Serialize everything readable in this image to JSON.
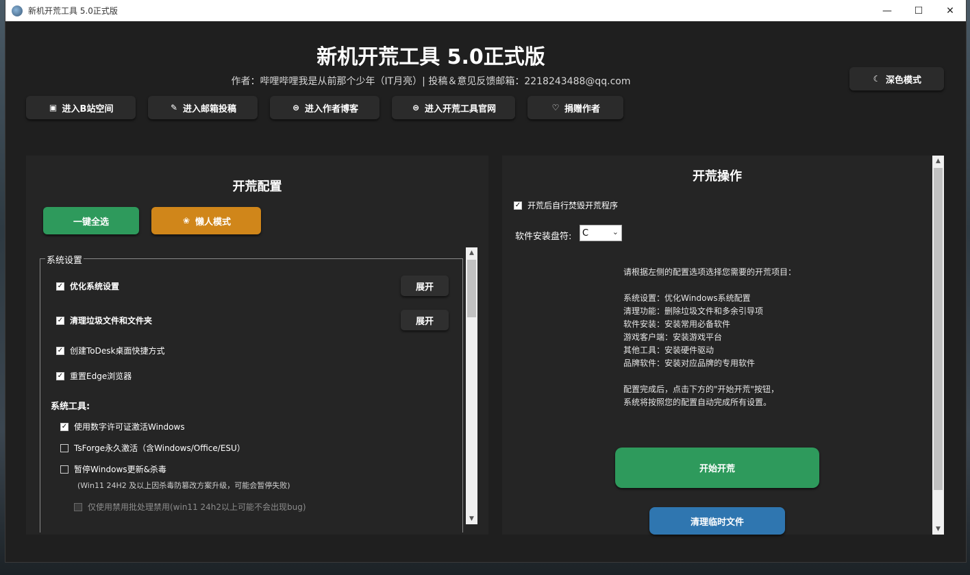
{
  "window": {
    "title": "新机开荒工具 5.0正式版",
    "minimize": "—",
    "maximize": "☐",
    "close": "✕"
  },
  "header": {
    "title": "新机开荒工具 5.0正式版",
    "subtitle": "作者：哔哩哔哩我是从前那个少年（IT月亮）| 投稿＆意见反馈邮箱：2218243488@qq.com",
    "dark_mode_label": "深色模式"
  },
  "nav": [
    {
      "label": "进入B站空间",
      "icon": "tv-icon"
    },
    {
      "label": "进入邮箱投稿",
      "icon": "edit-icon"
    },
    {
      "label": "进入作者博客",
      "icon": "globe-icon"
    },
    {
      "label": "进入开荒工具官网",
      "icon": "globe-icon"
    },
    {
      "label": "捐赠作者",
      "icon": "heart-icon"
    }
  ],
  "left": {
    "title": "开荒配置",
    "select_all": "一键全选",
    "lazy_mode": "懒人模式",
    "group_label": "系统设置",
    "items": [
      {
        "label": "优化系统设置",
        "checked": true,
        "expand": "展开"
      },
      {
        "label": "清理垃圾文件和文件夹",
        "checked": true,
        "expand": "展开"
      },
      {
        "label": "创建ToDesk桌面快捷方式",
        "checked": true
      },
      {
        "label": "重置Edge浏览器",
        "checked": true
      }
    ],
    "tools_label": "系统工具:",
    "tools": [
      {
        "label": "使用数字许可证激活Windows",
        "checked": true
      },
      {
        "label": "TsForge永久激活（含Windows/Office/ESU）",
        "checked": false
      },
      {
        "label": "暂停Windows更新&杀毒",
        "checked": false
      }
    ],
    "note": "(Win11 24H2 及以上因杀毒防篡改方案升级，可能会暂停失败)",
    "sub_option": "仅使用禁用批处理禁用(win11 24h2以上可能不会出现bug)"
  },
  "right": {
    "title": "开荒操作",
    "self_destroy": "开荒后自行焚毁开荒程序",
    "drive_label": "软件安装盘符:",
    "drive_value": "C",
    "info_lines": [
      "请根据左侧的配置选项选择您需要的开荒项目：",
      "",
      "系统设置：优化Windows系统配置",
      "清理功能：删除垃圾文件和多余引导项",
      "软件安装：安装常用必备软件",
      "游戏客户端：安装游戏平台",
      "其他工具：安装硬件驱动",
      "品牌软件：安装对应品牌的专用软件",
      "",
      "配置完成后，点击下方的\"开始开荒\"按钮，",
      "系统将按照您的配置自动完成所有设置。"
    ],
    "start_btn": "开始开荒",
    "clean_btn": "清理临时文件"
  },
  "colors": {
    "green": "#2e9a5c",
    "orange": "#d0861a",
    "blue": "#2f76b0",
    "bg": "#1f1f1f",
    "panel": "#252525"
  }
}
